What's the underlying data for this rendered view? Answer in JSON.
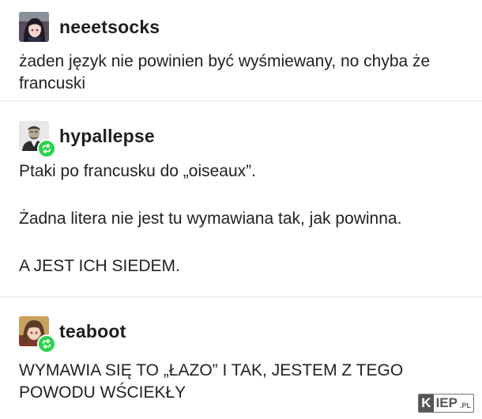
{
  "posts": [
    {
      "username": "neeetsocks",
      "avatar_icon": "anime-girl-avatar-icon",
      "reblog": false,
      "paragraphs": [
        "żaden język nie powinien być wyśmiewany, no chyba że francuski"
      ]
    },
    {
      "username": "hypallepse",
      "avatar_icon": "portrait-man-avatar-icon",
      "reblog": true,
      "paragraphs": [
        "Ptaki po francusku do „oiseaux”.",
        "Żadna litera nie jest tu wymawiana tak, jak powinna.",
        "A JEST ICH SIEDEM."
      ]
    },
    {
      "username": "teaboot",
      "avatar_icon": "anime-character-avatar-icon",
      "reblog": true,
      "paragraphs": [
        "WYMAWIA SIĘ TO „ŁAZO” I TAK, JESTEM Z TEGO POWODU WŚCIEKŁY"
      ]
    }
  ],
  "watermark": {
    "k": "K",
    "iep": "IEP",
    "pl": ".PL"
  },
  "colors": {
    "reblog_badge": "#2bd44f",
    "divider": "#e6e6e6",
    "text": "#222222"
  }
}
